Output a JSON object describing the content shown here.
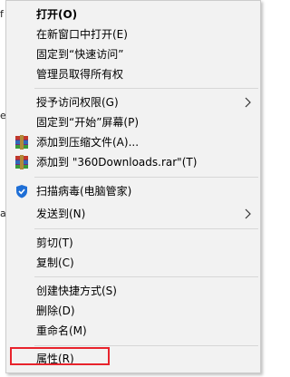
{
  "context_menu": {
    "items": [
      {
        "label": "打开(O)",
        "bold": true
      },
      {
        "label": "在新窗口中打开(E)"
      },
      {
        "label": "固定到“快速访问”"
      },
      {
        "label": "管理员取得所有权"
      },
      {
        "label": "授予访问权限(G)",
        "submenu": true
      },
      {
        "label": "固定到“开始”屏幕(P)"
      },
      {
        "label": "添加到压缩文件(A)...",
        "icon": "winrar-icon"
      },
      {
        "label": "添加到 \"360Downloads.rar\"(T)",
        "icon": "winrar-icon"
      },
      {
        "label": "扫描病毒(电脑管家)",
        "icon": "shield-icon"
      },
      {
        "label": "发送到(N)",
        "submenu": true
      },
      {
        "label": "剪切(T)"
      },
      {
        "label": "复制(C)"
      },
      {
        "label": "创建快捷方式(S)"
      },
      {
        "label": "删除(D)"
      },
      {
        "label": "重命名(M)"
      },
      {
        "label": "属性(R)",
        "highlighted": true
      }
    ]
  },
  "colors": {
    "menu_bg": "#f2f2f2",
    "separator": "#d7d7d7",
    "highlight_border": "#e8232c",
    "shield_blue": "#1f6fd6"
  }
}
